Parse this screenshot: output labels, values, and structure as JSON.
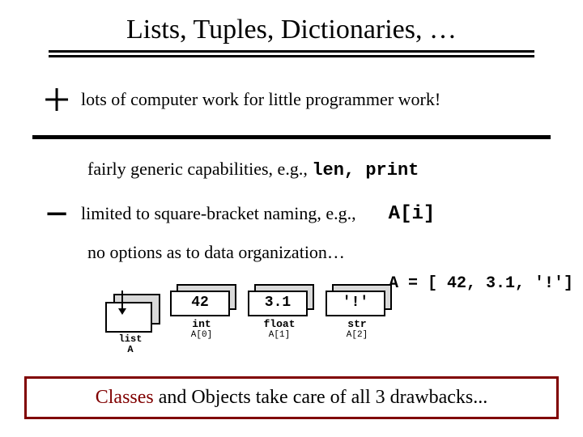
{
  "title": "Lists, Tuples, Dictionaries, …",
  "plus_sign": "+",
  "plus_text": "lots of computer work for little programmer work!",
  "line1_prefix": "fairly generic capabilities, e.g., ",
  "line1_code": "len, print",
  "minus_sign": "−",
  "line2_text": "limited to square-bracket naming, e.g.,",
  "line2_code": "A[i]",
  "line3_text": "no options as to data organization…",
  "assign_code": "A = [ 42, 3.1, '!']",
  "listbox": {
    "l1": "list",
    "l2": "A"
  },
  "cells": [
    {
      "val": "42",
      "type": "int",
      "idx": "A[0]"
    },
    {
      "val": "3.1",
      "type": "float",
      "idx": "A[1]"
    },
    {
      "val": "'!'",
      "type": "str",
      "idx": "A[2]"
    }
  ],
  "footer_first": "Classes",
  "footer_rest": " and Objects take care of all 3 drawbacks..."
}
